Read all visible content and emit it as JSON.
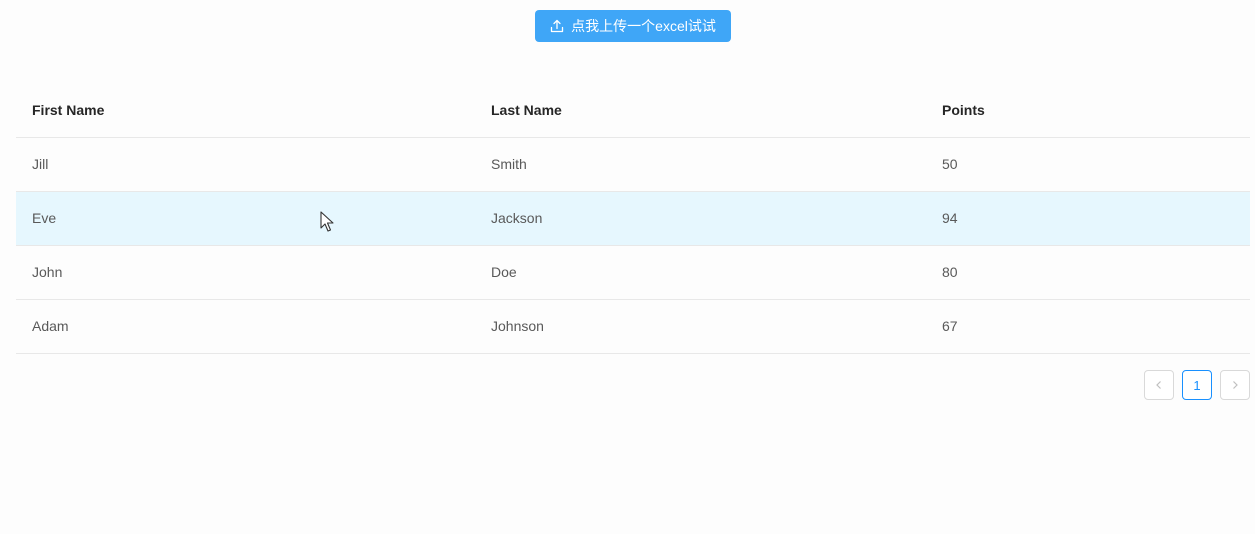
{
  "upload": {
    "label": "点我上传一个excel试试",
    "icon": "upload-icon",
    "color": "#3fa6f7"
  },
  "table": {
    "columns": [
      "First Name",
      "Last Name",
      "Points"
    ],
    "rows": [
      {
        "first": "Jill",
        "last": "Smith",
        "points": "50"
      },
      {
        "first": "Eve",
        "last": "Jackson",
        "points": "94"
      },
      {
        "first": "John",
        "last": "Doe",
        "points": "80"
      },
      {
        "first": "Adam",
        "last": "Johnson",
        "points": "67"
      }
    ],
    "hover_row_color": "#e6f7fe"
  },
  "pagination": {
    "prev_icon": "chevron-left-icon",
    "current_page": "1",
    "next_icon": "chevron-right-icon",
    "active_color": "#1890ff"
  }
}
